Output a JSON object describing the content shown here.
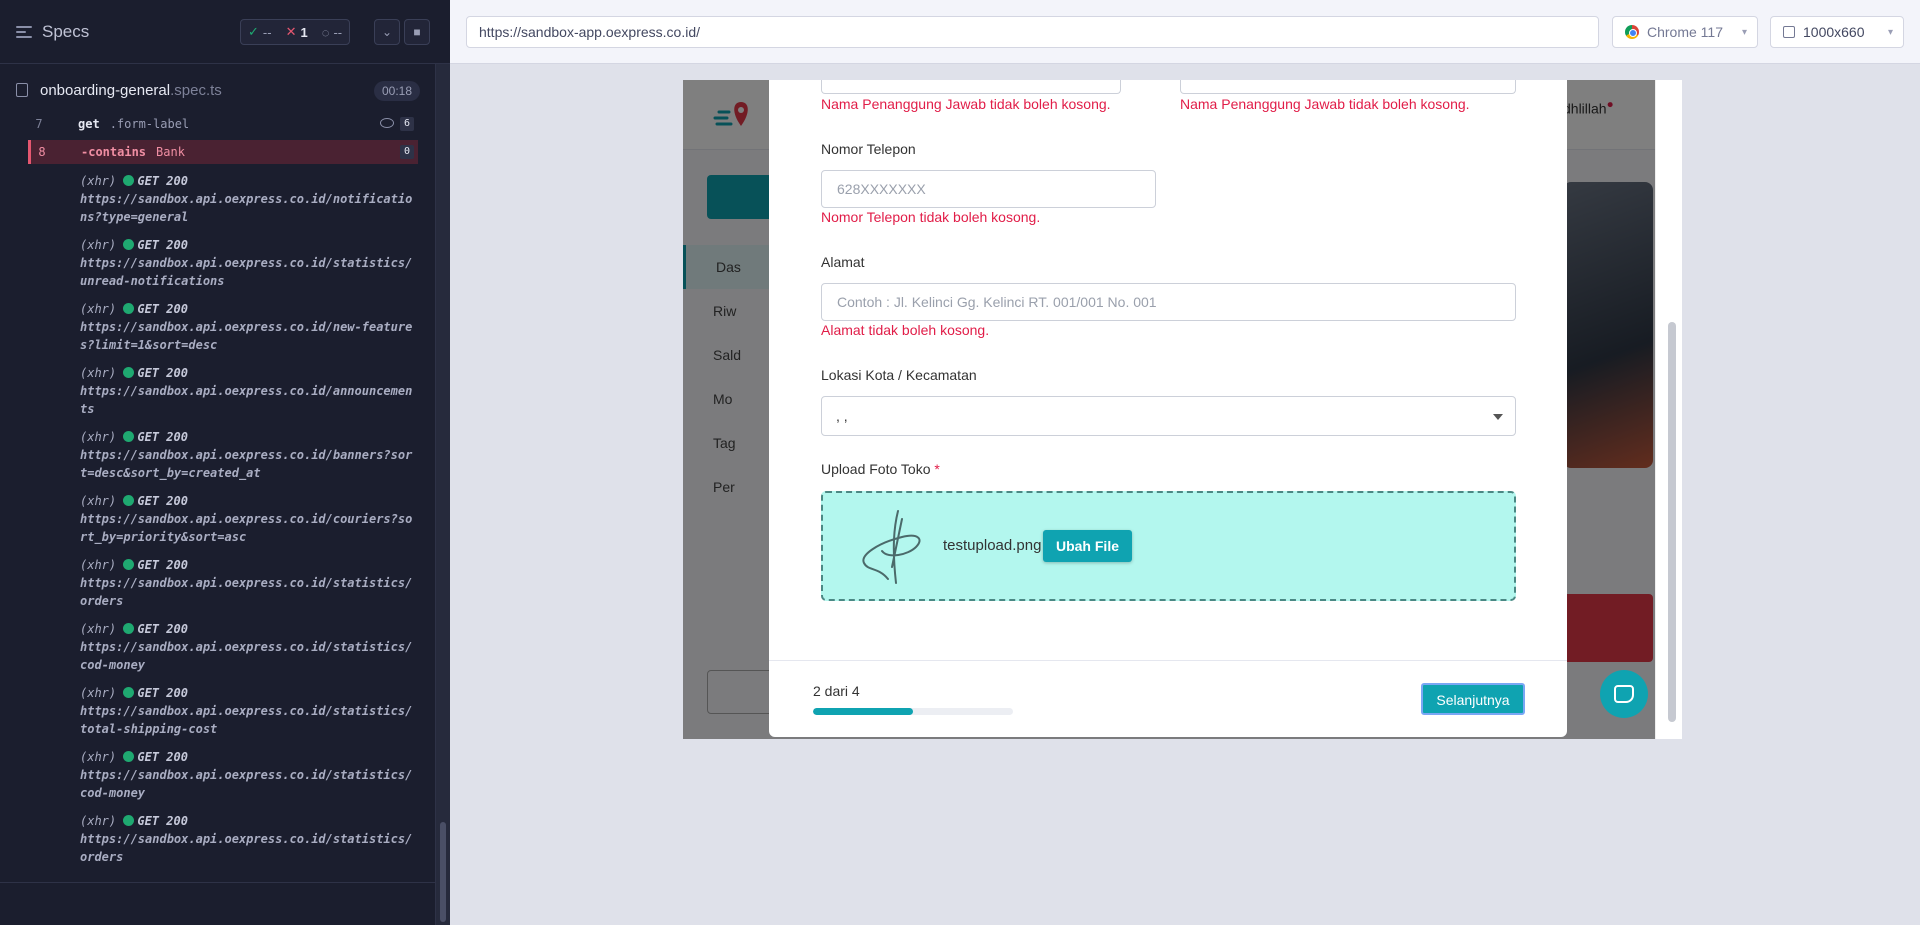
{
  "runner": {
    "title": "Specs",
    "stats": {
      "passed": "--",
      "failed": "1",
      "pending": "--"
    },
    "spec": {
      "name": "onboarding-general",
      "ext": ".spec.ts",
      "duration": "00:18"
    },
    "commands": [
      {
        "num": "7",
        "name": "get",
        "arg": ".form-label",
        "badge": "6"
      },
      {
        "num": "8",
        "name": "-contains",
        "arg": "Bank",
        "badge": "0"
      }
    ],
    "requests": [
      {
        "type": "(xhr)",
        "method": "GET 200",
        "url": "https://sandbox.api.oexpress.co.id/notifications?type=general"
      },
      {
        "type": "(xhr)",
        "method": "GET 200",
        "url": "https://sandbox.api.oexpress.co.id/statistics/unread-notifications"
      },
      {
        "type": "(xhr)",
        "method": "GET 200",
        "url": "https://sandbox.api.oexpress.co.id/new-features?limit=1&sort=desc"
      },
      {
        "type": "(xhr)",
        "method": "GET 200",
        "url": "https://sandbox.api.oexpress.co.id/announcements"
      },
      {
        "type": "(xhr)",
        "method": "GET 200",
        "url": "https://sandbox.api.oexpress.co.id/banners?sort=desc&sort_by=created_at"
      },
      {
        "type": "(xhr)",
        "method": "GET 200",
        "url": "https://sandbox.api.oexpress.co.id/couriers?sort_by=priority&sort=asc"
      },
      {
        "type": "(xhr)",
        "method": "GET 200",
        "url": "https://sandbox.api.oexpress.co.id/statistics/orders"
      },
      {
        "type": "(xhr)",
        "method": "GET 200",
        "url": "https://sandbox.api.oexpress.co.id/statistics/cod-money"
      },
      {
        "type": "(xhr)",
        "method": "GET 200",
        "url": "https://sandbox.api.oexpress.co.id/statistics/total-shipping-cost"
      },
      {
        "type": "(xhr)",
        "method": "GET 200",
        "url": "https://sandbox.api.oexpress.co.id/statistics/cod-money"
      },
      {
        "type": "(xhr)",
        "method": "GET 200",
        "url": "https://sandbox.api.oexpress.co.id/statistics/orders"
      }
    ]
  },
  "topbar": {
    "url": "https://sandbox-app.oexpress.co.id/",
    "browser": "Chrome 117",
    "viewport": "1000x660"
  },
  "app": {
    "user": "dhlillah",
    "nav": [
      "Das",
      "Riw",
      "Sald",
      "Mo",
      "Tag",
      "Per"
    ]
  },
  "form": {
    "pj_error_1": "Nama Penanggung Jawab tidak boleh kosong.",
    "pj_error_2": "Nama Penanggung Jawab tidak boleh kosong.",
    "phone_label": "Nomor Telepon",
    "phone_placeholder": "628XXXXXXX",
    "phone_error": "Nomor Telepon tidak boleh kosong.",
    "address_label": "Alamat",
    "address_placeholder": "Contoh : Jl. Kelinci Gg. Kelinci RT. 001/001 No. 001",
    "address_error": "Alamat tidak boleh kosong.",
    "location_label": "Lokasi Kota / Kecamatan",
    "location_value": ", ,",
    "upload_label": "Upload Foto Toko",
    "upload_required": "*",
    "file_name": "testupload.png",
    "change_file": "Ubah File",
    "step": "2 dari 4",
    "progress": 0.5,
    "next": "Selanjutnya"
  },
  "colors": {
    "accent": "#0fa3b1",
    "error": "#e11d48",
    "pass": "#1fa971",
    "fail": "#e45770"
  }
}
